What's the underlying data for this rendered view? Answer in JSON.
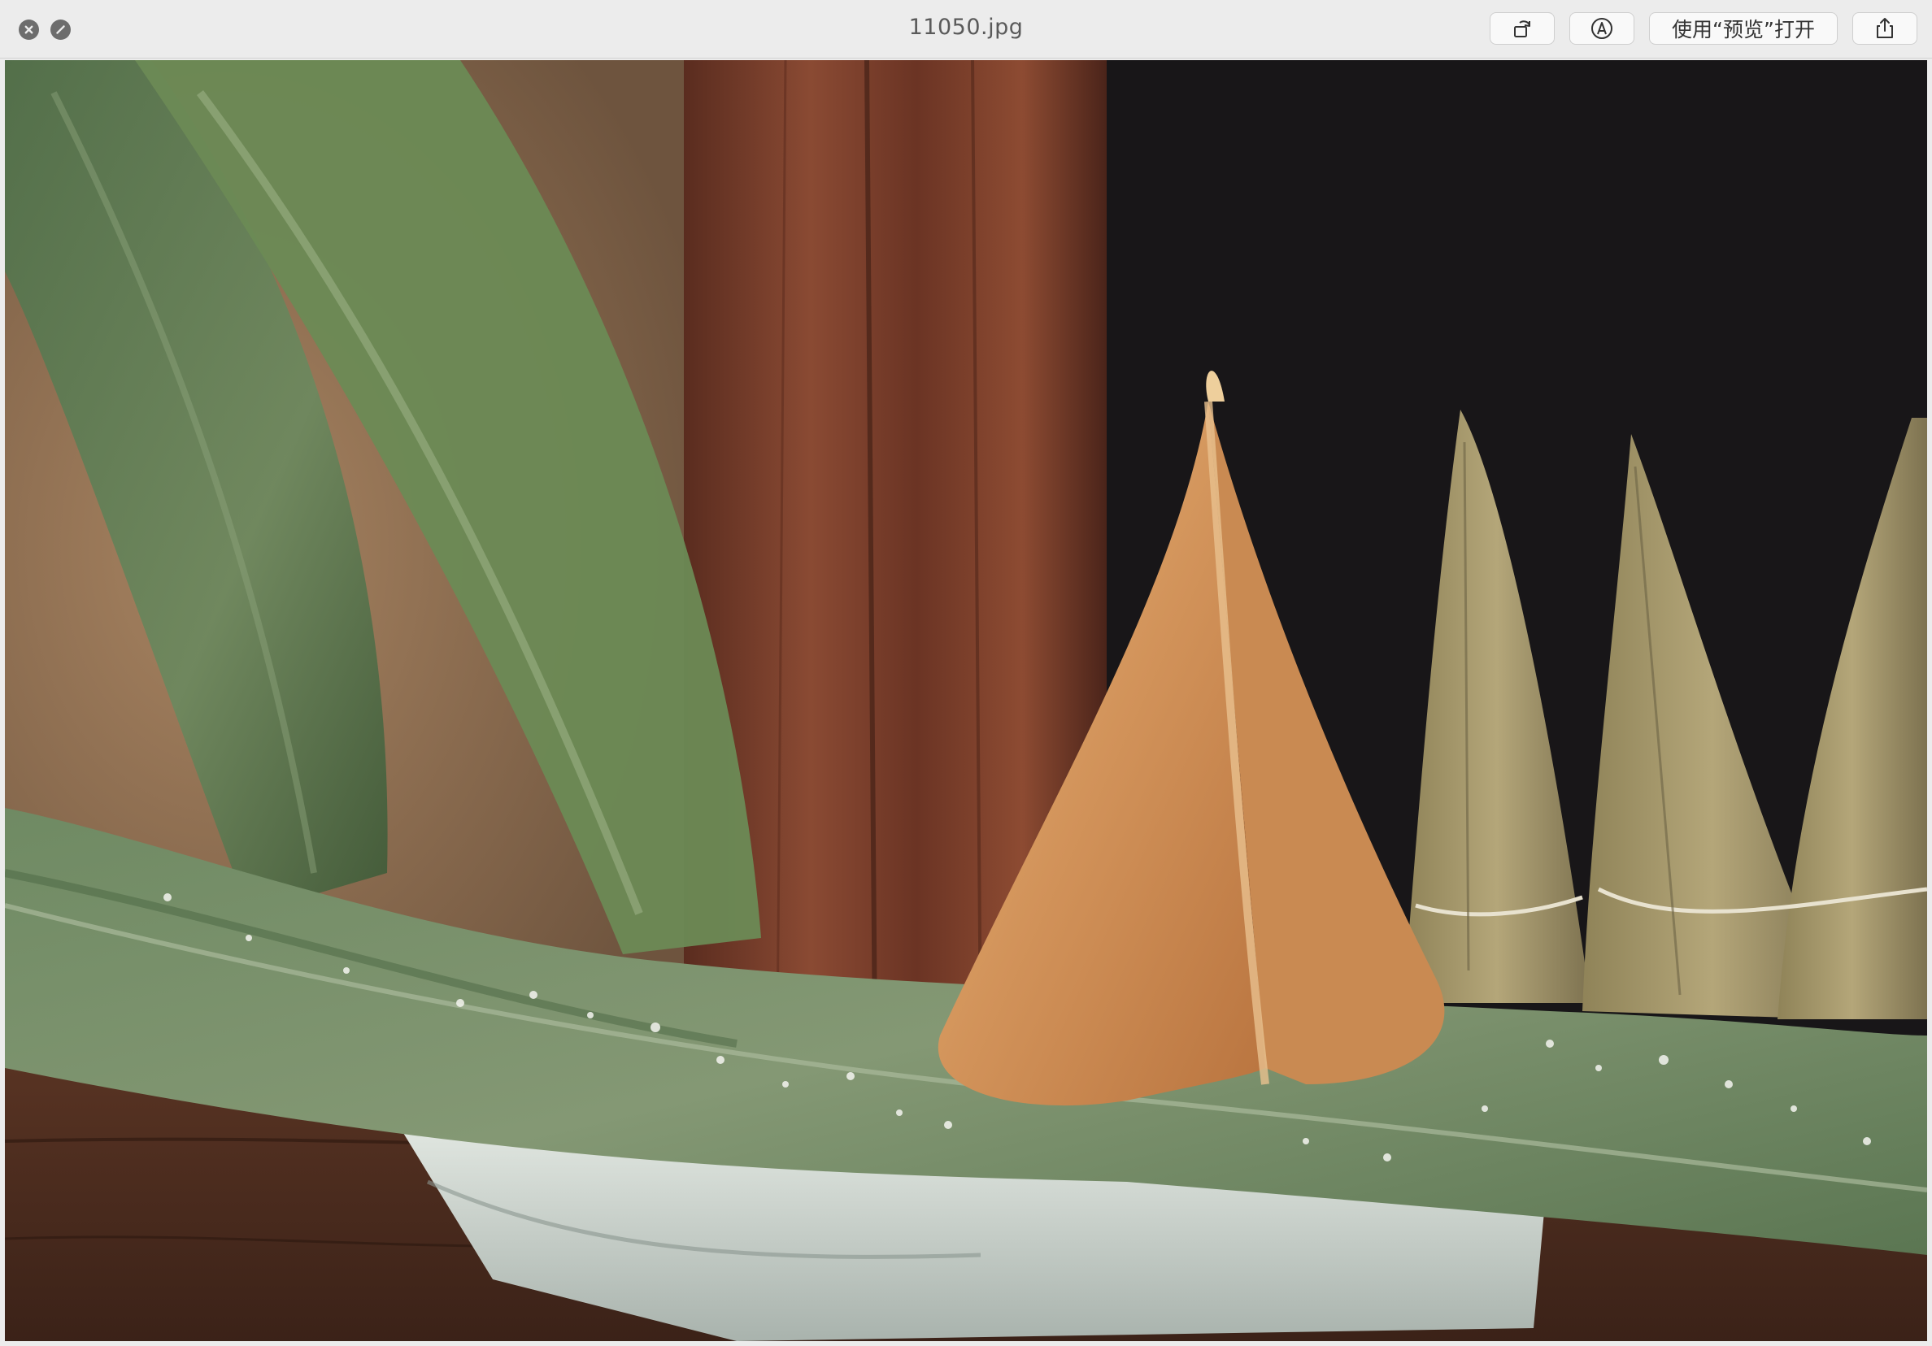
{
  "window": {
    "title": "11050.jpg",
    "controls": {
      "close_icon": "close-icon",
      "fullscreen_icon": "fullscreen-icon"
    }
  },
  "toolbar": {
    "rotate_icon": "rotate-icon",
    "markup_icon": "markup-icon",
    "open_with_label": "使用“预览”打开",
    "share_icon": "share-icon"
  },
  "image": {
    "file_name": "11050.jpg"
  },
  "colors": {
    "titlebar": "#ececec",
    "leaf_green": "#6f8760",
    "zongzi": "#d79a5c",
    "wood": "#7b3f2a",
    "dark_bg": "#181618"
  }
}
